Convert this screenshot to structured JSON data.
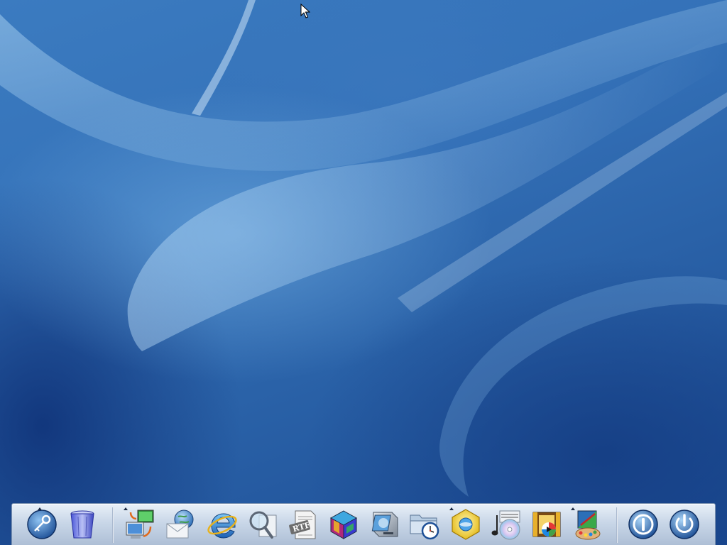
{
  "desktop": {
    "wallpaper": "blue-aurora-swirl",
    "colors": {
      "wallpaper_light": "#6fa7da",
      "wallpaper_dark": "#1b4a92",
      "dock_bg": "#c9d7e8"
    }
  },
  "dock": {
    "items": [
      {
        "icon": "key-icon",
        "running": true
      },
      {
        "icon": "trash-icon",
        "running": false
      },
      {
        "icon": "network-computers-icon",
        "running": true
      },
      {
        "icon": "mail-icon",
        "running": false
      },
      {
        "icon": "internet-explorer-icon",
        "running": false
      },
      {
        "icon": "search-magnifier-icon",
        "running": false
      },
      {
        "icon": "rtf-document-icon",
        "running": false
      },
      {
        "icon": "3d-cube-icon",
        "running": false
      },
      {
        "icon": "disk-drive-icon",
        "running": false
      },
      {
        "icon": "scheduled-folder-icon",
        "running": false
      },
      {
        "icon": "settings-hexagon-icon",
        "running": true
      },
      {
        "icon": "music-cd-icon",
        "running": false
      },
      {
        "icon": "video-film-icon",
        "running": false
      },
      {
        "icon": "paint-palette-icon",
        "running": true
      },
      {
        "icon": "logoff-icon",
        "running": false
      },
      {
        "icon": "shutdown-icon",
        "running": false
      }
    ],
    "rtf_label": "RTF"
  }
}
